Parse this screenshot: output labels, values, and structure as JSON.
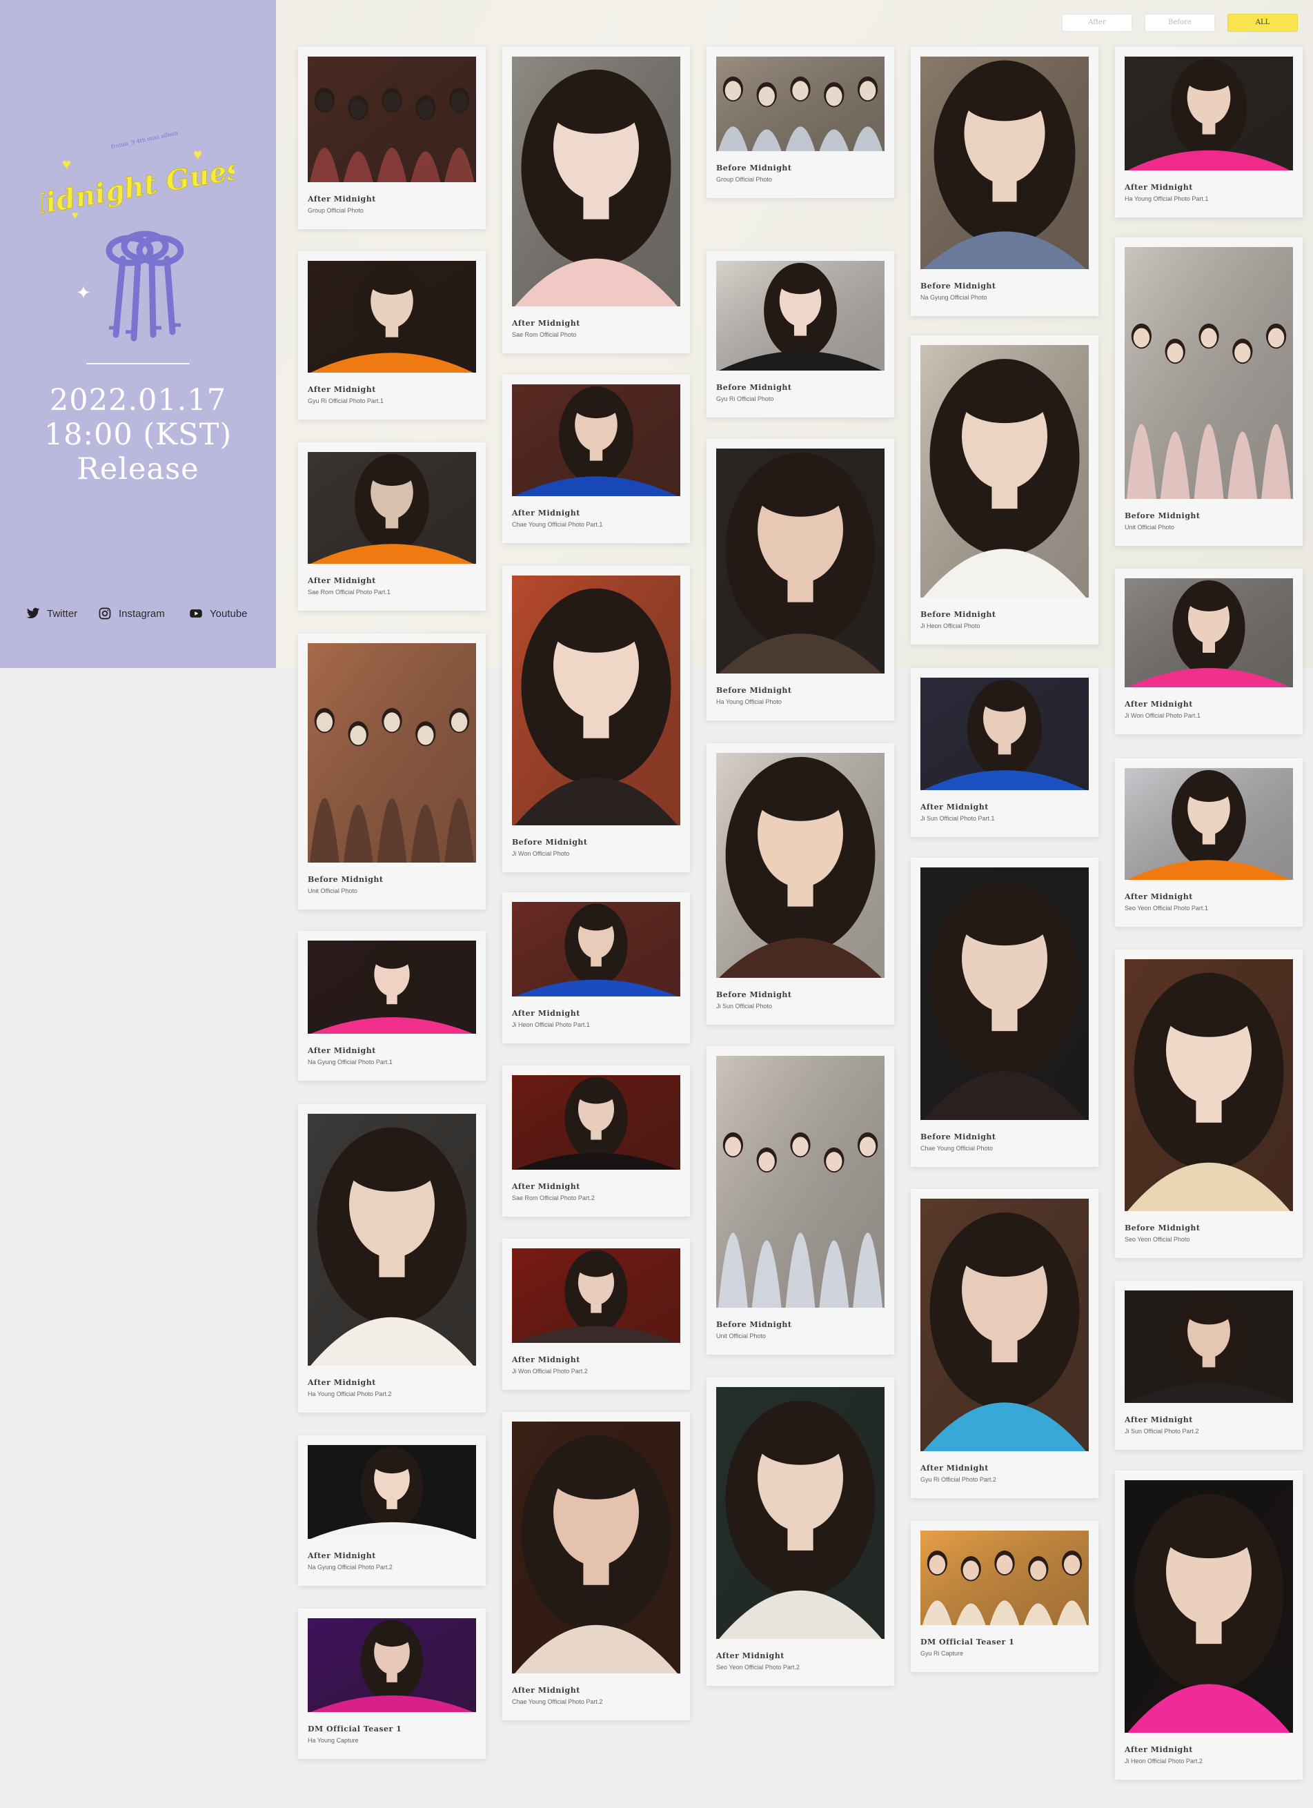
{
  "sidebar": {
    "logo_text": "Midnight Guest",
    "logo_subtext": "fromis_9 4th mini album",
    "release_date": "2022.01.17",
    "release_time": "18:00 (KST)",
    "release_label": "Release",
    "social": [
      {
        "label": "Twitter",
        "icon": "twitter-icon"
      },
      {
        "label": "Instagram",
        "icon": "instagram-icon"
      },
      {
        "label": "Youtube",
        "icon": "youtube-icon"
      }
    ]
  },
  "filters": [
    {
      "label": "After",
      "active": false
    },
    {
      "label": "Before",
      "active": false
    },
    {
      "label": "ALL",
      "active": true
    }
  ],
  "colors": {
    "sidebar": "#bbb8dd",
    "active_filter": "#f7e44f",
    "logo_yellow": "#f6ec3f",
    "logo_keys": "#7a74d0"
  },
  "columns": [
    [
      {
        "title": "After Midnight",
        "subtitle": "Group Official Photo",
        "palette": [
          "#4a2a22",
          "#8a3e3a",
          "#2b2420"
        ],
        "scene": "group"
      },
      {
        "title": "After Midnight",
        "subtitle": "Gyu Ri Official Photo Part.1",
        "palette": [
          "#2a1c16",
          "#f07a12",
          "#e9d0bd"
        ],
        "scene": "solo"
      },
      {
        "title": "After Midnight",
        "subtitle": "Sae Rom Official Photo Part.1",
        "palette": [
          "#3a3430",
          "#f07a12",
          "#d9c0ac"
        ],
        "scene": "solo"
      },
      {
        "title": "Before Midnight",
        "subtitle": "Unit Official Photo",
        "palette": [
          "#a86a4c",
          "#5a3a2c",
          "#e9d9c9"
        ],
        "scene": "group"
      },
      {
        "title": "After Midnight",
        "subtitle": "Na Gyung Official Photo Part.1",
        "palette": [
          "#2a1a1c",
          "#f0308a",
          "#efd2c4"
        ],
        "scene": "solo"
      },
      {
        "title": "After Midnight",
        "subtitle": "Ha Young Official Photo Part.2",
        "palette": [
          "#3c3a38",
          "#f2eee6",
          "#ead2c0"
        ],
        "scene": "solo"
      },
      {
        "title": "After Midnight",
        "subtitle": "Na Gyung Official Photo Part.2",
        "palette": [
          "#141414",
          "#f4f4f4",
          "#f0d6c6"
        ],
        "scene": "solo"
      },
      {
        "title": "DM Official Teaser 1",
        "subtitle": "Ha Young Capture",
        "palette": [
          "#40125c",
          "#d8208a",
          "#e8c8b8"
        ],
        "scene": "solo"
      }
    ],
    [
      {
        "title": "After Midnight",
        "subtitle": "Sae Rom Official Photo",
        "palette": [
          "#8e8a84",
          "#f0c8c4",
          "#efd8cc"
        ],
        "scene": "solo"
      },
      {
        "title": "After Midnight",
        "subtitle": "Chae Young Official Photo Part.1",
        "palette": [
          "#5a2a22",
          "#1848b8",
          "#e8cbb8"
        ],
        "scene": "solo"
      },
      {
        "title": "Before Midnight",
        "subtitle": "Ji Won Official Photo",
        "palette": [
          "#b84a2c",
          "#2a2220",
          "#f0d6c6"
        ],
        "scene": "solo"
      },
      {
        "title": "After Midnight",
        "subtitle": "Ji Heon Official Photo Part.1",
        "palette": [
          "#6a2a22",
          "#1a4cc0",
          "#e8cbb8"
        ],
        "scene": "solo"
      },
      {
        "title": "After Midnight",
        "subtitle": "Sae Rom Official Photo Part.2",
        "palette": [
          "#6a1a12",
          "#181212",
          "#e8ccbc"
        ],
        "scene": "solo"
      },
      {
        "title": "After Midnight",
        "subtitle": "Ji Won Official Photo Part.2",
        "palette": [
          "#7a1a12",
          "#3a2a2a",
          "#e8ccbc"
        ],
        "scene": "solo"
      },
      {
        "title": "After Midnight",
        "subtitle": "Chae Young Official Photo Part.2",
        "palette": [
          "#3a1e14",
          "#e8d6c8",
          "#e4c2ae"
        ],
        "scene": "solo"
      }
    ],
    [
      {
        "title": "Before Midnight",
        "subtitle": "Group Official Photo",
        "palette": [
          "#9a8e80",
          "#c8d0dc",
          "#e8d8cc"
        ],
        "scene": "group"
      },
      {
        "title": "Before Midnight",
        "subtitle": "Gyu Ri Official Photo",
        "palette": [
          "#d6d2cc",
          "#1c1a1a",
          "#efd6c8"
        ],
        "scene": "solo"
      },
      {
        "title": "Before Midnight",
        "subtitle": "Ha Young Official Photo",
        "palette": [
          "#2a2624",
          "#4a3a30",
          "#e6c8b4"
        ],
        "scene": "solo"
      },
      {
        "title": "Before Midnight",
        "subtitle": "Ji Sun Official Photo",
        "palette": [
          "#d6d0c8",
          "#4a2a20",
          "#ecd0bc"
        ],
        "scene": "solo"
      },
      {
        "title": "Before Midnight",
        "subtitle": "Unit Official Photo",
        "palette": [
          "#cac4bc",
          "#d6dae4",
          "#ecd6c8"
        ],
        "scene": "group"
      },
      {
        "title": "After Midnight",
        "subtitle": "Seo Yeon Official Photo Part.2",
        "palette": [
          "#24302c",
          "#e8e4dc",
          "#ecd2c0"
        ],
        "scene": "solo"
      }
    ],
    [
      {
        "title": "Before Midnight",
        "subtitle": "Na Gyung Official Photo",
        "palette": [
          "#8a7a6a",
          "#6a7a9a",
          "#ecd2c0"
        ],
        "scene": "solo"
      },
      {
        "title": "Before Midnight",
        "subtitle": "Ji Heon Official Photo",
        "palette": [
          "#cac2b4",
          "#f4f2ee",
          "#ecd4c2"
        ],
        "scene": "solo"
      },
      {
        "title": "After Midnight",
        "subtitle": "Ji Sun Official Photo Part.1",
        "palette": [
          "#2a2a3a",
          "#1a50c0",
          "#e8ccba"
        ],
        "scene": "solo"
      },
      {
        "title": "Before Midnight",
        "subtitle": "Chae Young Official Photo",
        "palette": [
          "#1c1c1c",
          "#2a2020",
          "#ead0c0"
        ],
        "scene": "solo"
      },
      {
        "title": "After Midnight",
        "subtitle": "Gyu Ri Official Photo Part.2",
        "palette": [
          "#5a3a2a",
          "#38a8d8",
          "#e8ccba"
        ],
        "scene": "solo"
      },
      {
        "title": "DM Official Teaser 1",
        "subtitle": "Gyu Ri Capture",
        "palette": [
          "#e8a048",
          "#f4e8d8",
          "#ecd0bc"
        ],
        "scene": "group"
      }
    ],
    [
      {
        "title": "After Midnight",
        "subtitle": "Ha Young Official Photo Part.1",
        "palette": [
          "#2a2622",
          "#f02a8a",
          "#ecd0be"
        ],
        "scene": "solo"
      },
      {
        "title": "Before Midnight",
        "subtitle": "Unit Official Photo",
        "palette": [
          "#cac4be",
          "#e8c8c4",
          "#ecd6c6"
        ],
        "scene": "group"
      },
      {
        "title": "After Midnight",
        "subtitle": "Ji Won Official Photo Part.1",
        "palette": [
          "#8a8684",
          "#f0308a",
          "#ecd0be"
        ],
        "scene": "solo"
      },
      {
        "title": "After Midnight",
        "subtitle": "Seo Yeon Official Photo Part.1",
        "palette": [
          "#c8c8cc",
          "#f07a10",
          "#ecd2c0"
        ],
        "scene": "solo"
      },
      {
        "title": "Before Midnight",
        "subtitle": "Seo Yeon Official Photo",
        "palette": [
          "#5a3424",
          "#e8d6b4",
          "#f0d8c8"
        ],
        "scene": "solo"
      },
      {
        "title": "After Midnight",
        "subtitle": "Ji Sun Official Photo Part.2",
        "palette": [
          "#201c18",
          "#242020",
          "#e4c6b2"
        ],
        "scene": "solo"
      },
      {
        "title": "After Midnight",
        "subtitle": "Ji Heon Official Photo Part.2",
        "palette": [
          "#141212",
          "#f02a98",
          "#ecd0be"
        ],
        "scene": "solo"
      }
    ]
  ]
}
